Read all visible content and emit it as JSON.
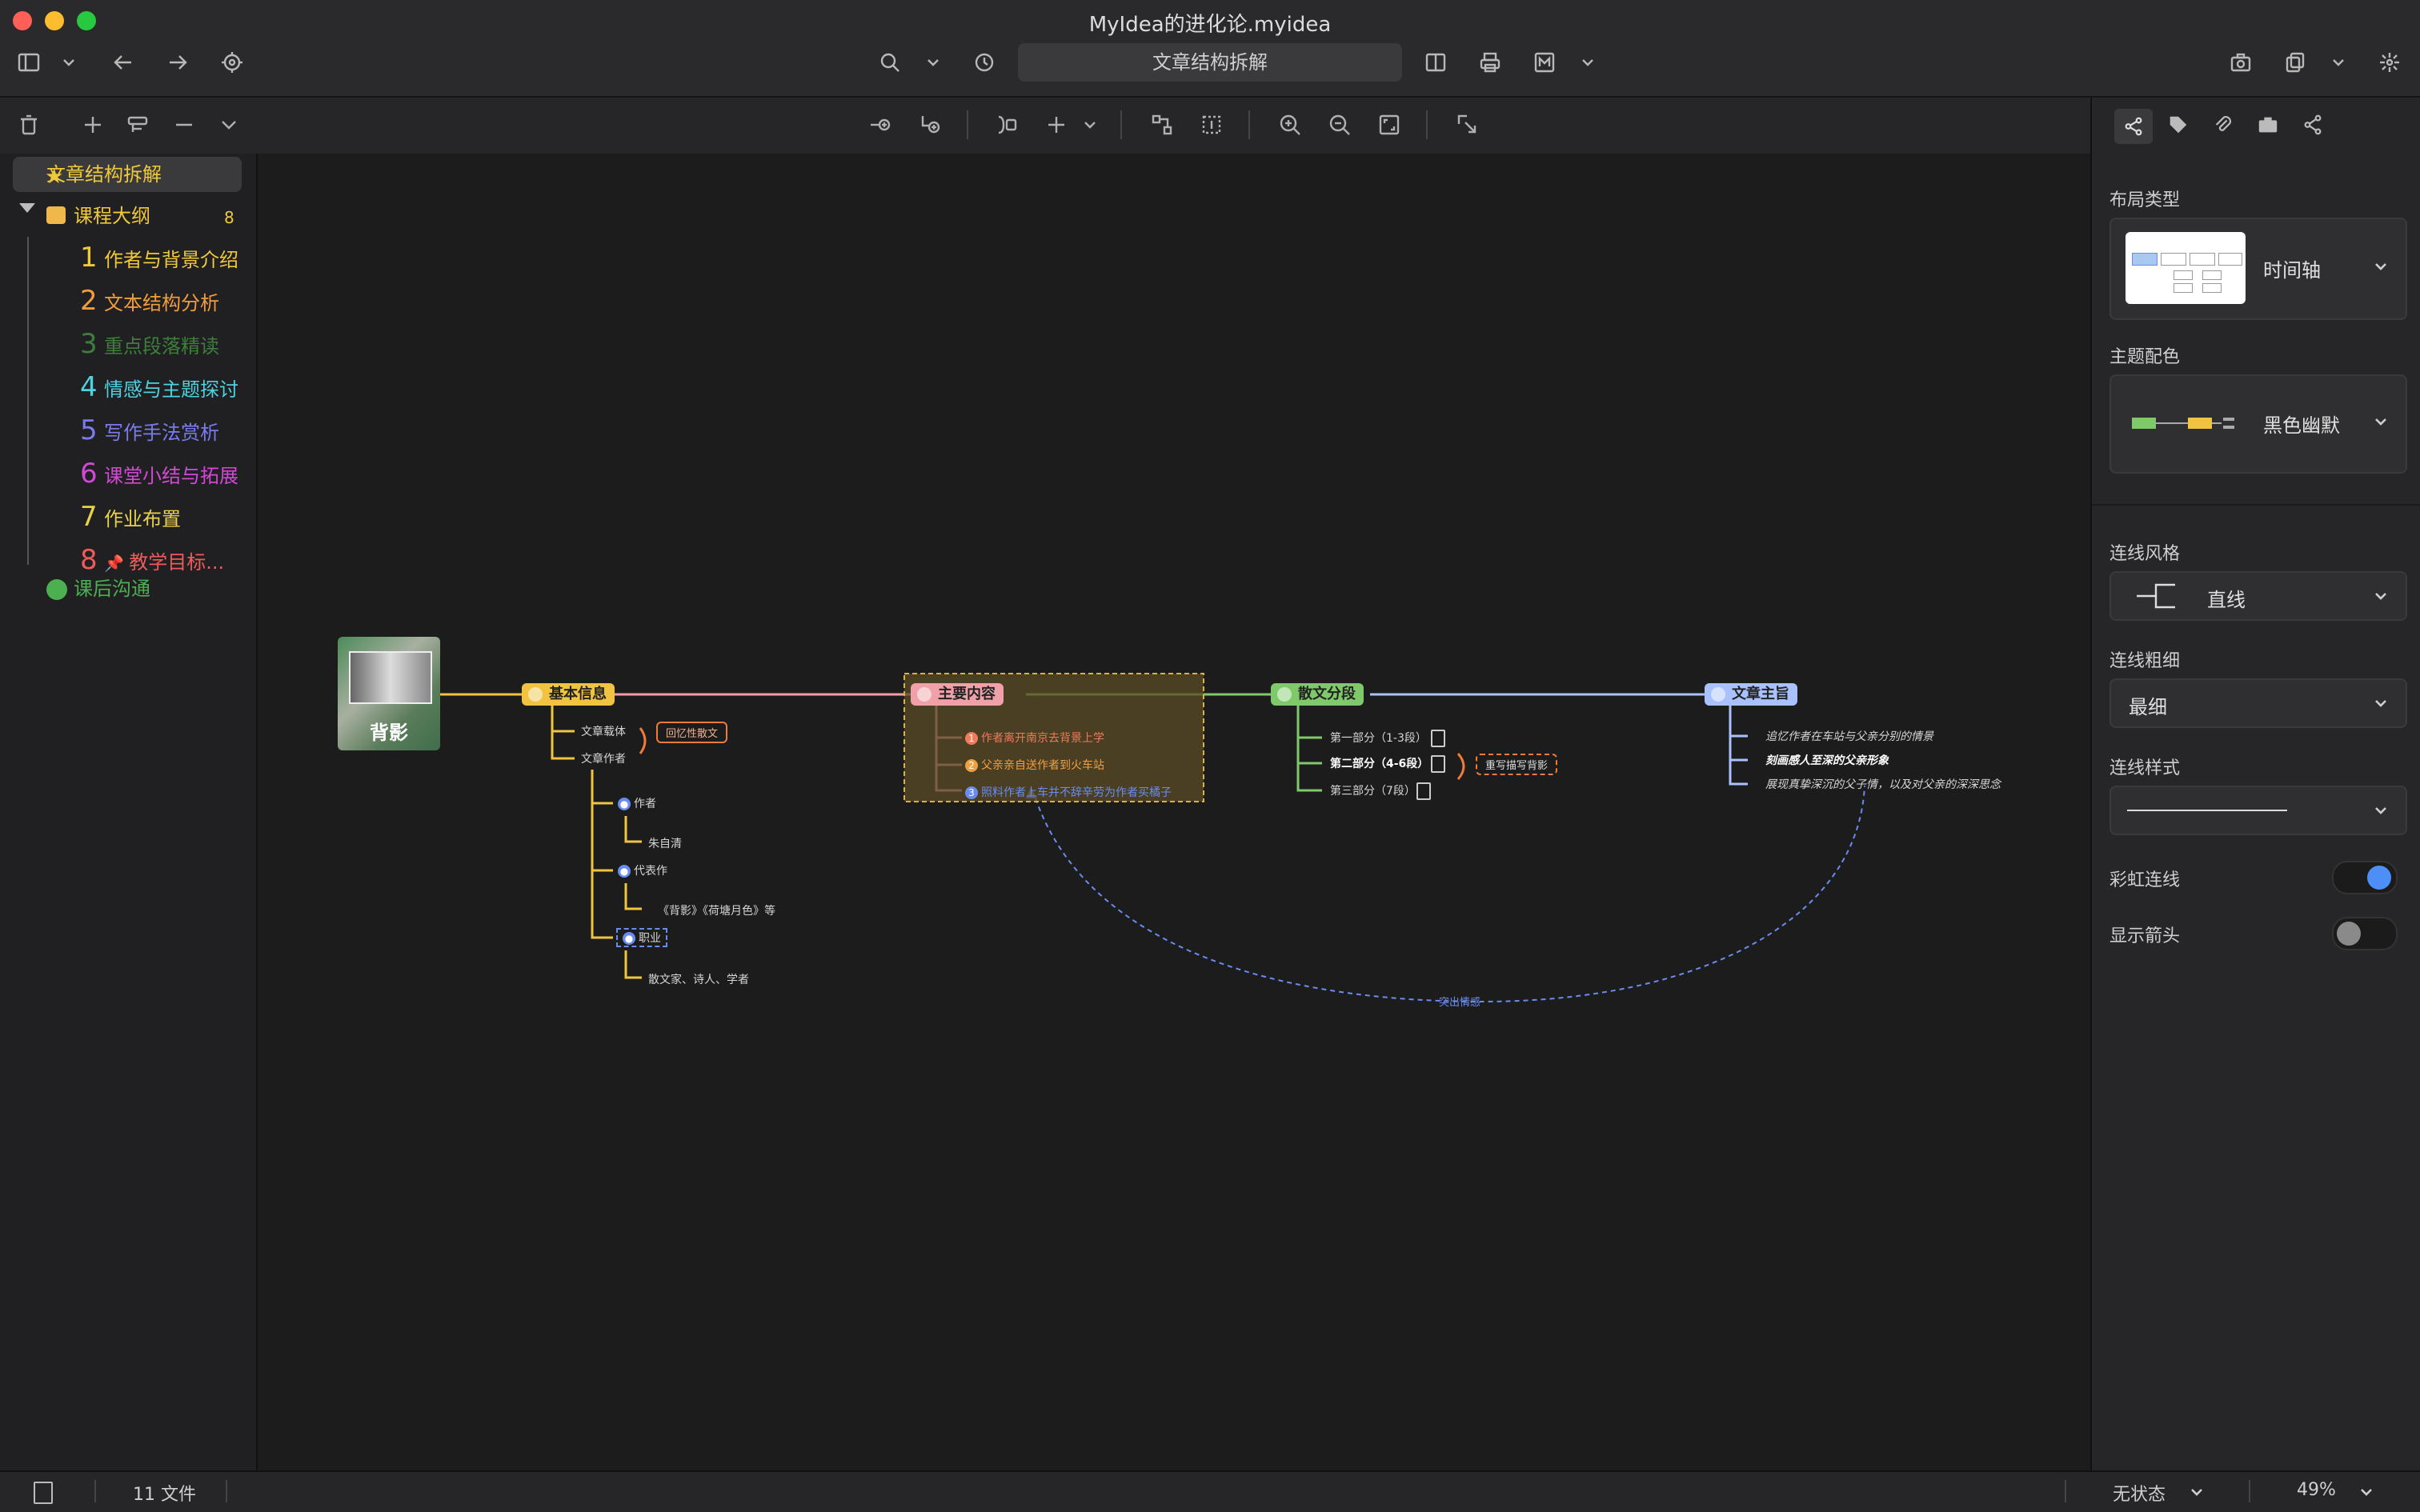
{
  "window": {
    "title": "MyIdea的进化论.myidea"
  },
  "toolbar": {
    "doc_title": "文章结构拆解"
  },
  "sidebar": {
    "root": "文章结构拆解",
    "group": {
      "label": "课程大纲",
      "count": "8"
    },
    "items": [
      {
        "num": "1",
        "label": "作者与背景介绍",
        "color": "#f0c93a"
      },
      {
        "num": "2",
        "label": "文本结构分析",
        "color": "#f39c3c"
      },
      {
        "num": "3",
        "label": "重点段落精读",
        "color": "#3f7e3a"
      },
      {
        "num": "4",
        "label": "情感与主题探讨",
        "color": "#4fd1e0"
      },
      {
        "num": "5",
        "label": "写作手法赏析",
        "color": "#7b7bf0"
      },
      {
        "num": "6",
        "label": "课堂小结与拓展",
        "color": "#d448d6"
      },
      {
        "num": "7",
        "label": "作业布置",
        "color": "#e8d24a"
      },
      {
        "num": "8",
        "label": "教学目标...",
        "color": "#ef5b5b"
      }
    ],
    "footer": "课后沟通"
  },
  "mindmap": {
    "root": "背影",
    "branches": {
      "basic": {
        "label": "基本信息",
        "color": "#f0c340"
      },
      "main": {
        "label": "主要内容",
        "color": "#f0a0a8"
      },
      "parts": {
        "label": "散文分段",
        "color": "#7fc96a"
      },
      "theme": {
        "label": "文章主旨",
        "color": "#a9c2ff"
      }
    },
    "basic_children": {
      "genre": "文章载体",
      "genre_tag": "回忆性散文",
      "author": "文章作者",
      "author_sub": "作者",
      "author_name": "朱自清",
      "works": "代表作",
      "works_name": "《背影》《荷塘月色》等",
      "job": "职业",
      "job_name": "散文家、诗人、学者"
    },
    "main_children": [
      {
        "n": "1",
        "text": "作者离开南京去背景上学",
        "color": "#f07a5a"
      },
      {
        "n": "2",
        "text": "父亲亲自送作者到火车站",
        "color": "#f0a040"
      },
      {
        "n": "3",
        "text": "照料作者上车并不辞辛劳为作者买橘子",
        "color": "#6a8cf0"
      }
    ],
    "parts_children": [
      "第一部分（1-3段）",
      "第二部分（4-6段）",
      "第三部分（7段）"
    ],
    "parts_tag": "重写描写背影",
    "theme_children": [
      "追忆作者在车站与父亲分别的情景",
      "刻画感人至深的父亲形象",
      "展现真挚深沉的父子情，以及对父亲的深深思念"
    ],
    "relation_label": "突出情感"
  },
  "panel": {
    "layout_label": "布局类型",
    "layout_value": "时间轴",
    "theme_label": "主题配色",
    "theme_value": "黑色幽默",
    "line_style_label": "连线风格",
    "line_style_value": "直线",
    "line_weight_label": "连线粗细",
    "line_weight_value": "最细",
    "line_type_label": "连线样式",
    "rainbow_label": "彩虹连线",
    "rainbow_on": true,
    "arrow_label": "显示箭头",
    "arrow_on": false
  },
  "statusbar": {
    "files": "11 文件",
    "state": "无状态",
    "zoom": "49%"
  }
}
